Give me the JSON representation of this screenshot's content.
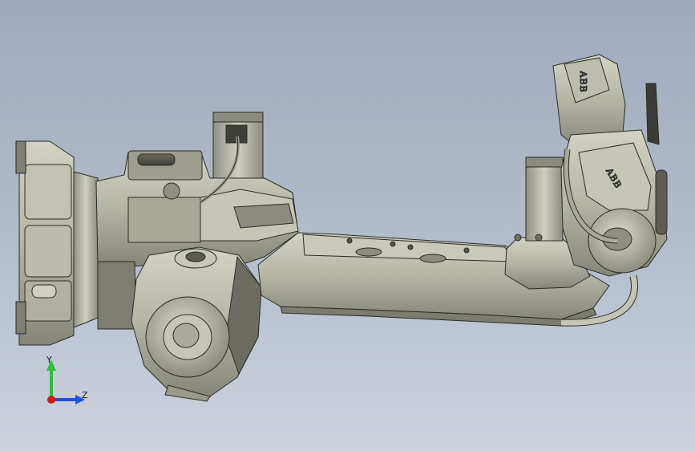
{
  "viewport": {
    "background_top": "#9fa9bc",
    "background_bottom": "#cdd3dd"
  },
  "model": {
    "body_color": "#b9b9a8",
    "shadow_color": "#6e6e62",
    "edge_color": "#2b2b26",
    "logo_1": "ABB",
    "logo_2": "ABB"
  },
  "triad": {
    "y_label": "Y",
    "z_label": "Z",
    "y_color": "#2fbf3a",
    "z_color": "#1f52d6",
    "x_color": "#d01818"
  }
}
